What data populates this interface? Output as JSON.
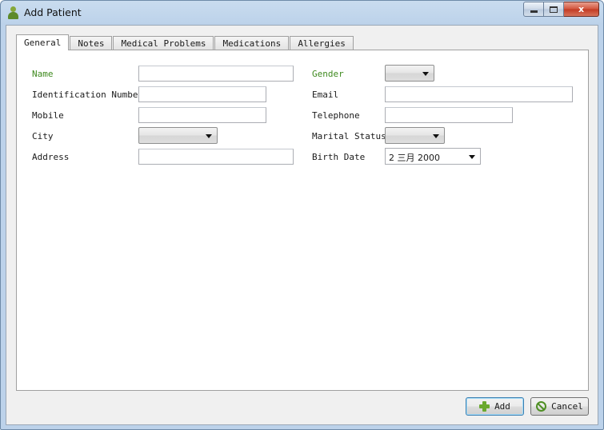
{
  "window": {
    "title": "Add Patient",
    "icon": "patient-icon"
  },
  "window_controls": {
    "close_glyph": "x"
  },
  "tabs": [
    {
      "label": "General",
      "active": true
    },
    {
      "label": "Notes",
      "active": false
    },
    {
      "label": "Medical Problems",
      "active": false
    },
    {
      "label": "Medications",
      "active": false
    },
    {
      "label": "Allergies",
      "active": false
    }
  ],
  "form": {
    "name": {
      "label": "Name",
      "value": "",
      "required": true
    },
    "identification_number": {
      "label": "Identification Number",
      "value": ""
    },
    "mobile": {
      "label": "Mobile",
      "value": ""
    },
    "city": {
      "label": "City",
      "selected": ""
    },
    "address": {
      "label": "Address",
      "value": ""
    },
    "gender": {
      "label": "Gender",
      "selected": "",
      "required": true
    },
    "email": {
      "label": "Email",
      "value": ""
    },
    "telephone": {
      "label": "Telephone",
      "value": ""
    },
    "marital_status": {
      "label": "Marital Status",
      "selected": ""
    },
    "birth_date": {
      "label": "Birth Date",
      "value": "2 三月 2000"
    }
  },
  "buttons": {
    "add": "Add",
    "cancel": "Cancel"
  },
  "colors": {
    "required_label": "#3f8a1f",
    "accent_icon": "#6aa92e"
  }
}
